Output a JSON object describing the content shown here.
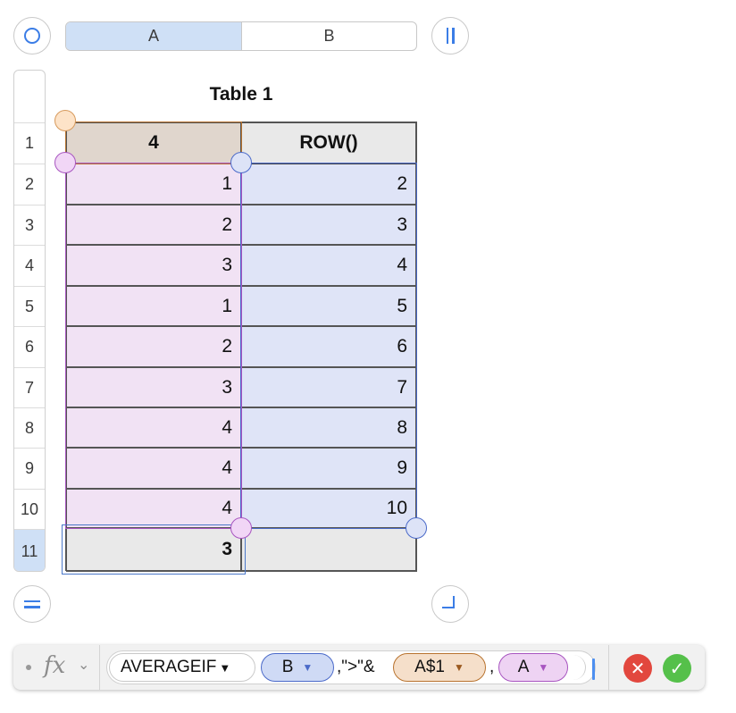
{
  "column_headers": [
    "A",
    "B"
  ],
  "row_numbers": [
    "1",
    "2",
    "3",
    "4",
    "5",
    "6",
    "7",
    "8",
    "9",
    "10",
    "11"
  ],
  "table": {
    "title": "Table 1",
    "header_row": [
      "4",
      "ROW()"
    ],
    "body_rows": [
      [
        "1",
        "2"
      ],
      [
        "2",
        "3"
      ],
      [
        "3",
        "4"
      ],
      [
        "1",
        "5"
      ],
      [
        "2",
        "6"
      ],
      [
        "3",
        "7"
      ],
      [
        "4",
        "8"
      ],
      [
        "4",
        "9"
      ],
      [
        "4",
        "10"
      ]
    ],
    "footer_row": [
      "3",
      ""
    ]
  },
  "formula_bar": {
    "fx_icon": "fx",
    "function_name": "AVERAGEIF",
    "tokens": {
      "range_ref": "B",
      "literal": ",\">\"&",
      "criteria_ref": "A$1",
      "comma": ",",
      "avg_ref": "A"
    }
  },
  "colors": {
    "selection_blue": "#4b78c9",
    "column_a_ref": "#a855c0",
    "column_b_ref": "#4b6ac9",
    "criteria_ref": "#b8732f",
    "cancel_red": "#e2473e",
    "accept_green": "#55c04a"
  },
  "icons": {
    "top_left": "circle-select-icon",
    "top_right": "pause-columns-icon",
    "bottom_left": "equals-rows-icon",
    "bottom_right": "corner-resize-icon",
    "cancel": "cancel-x-icon",
    "accept": "accept-check-icon"
  }
}
